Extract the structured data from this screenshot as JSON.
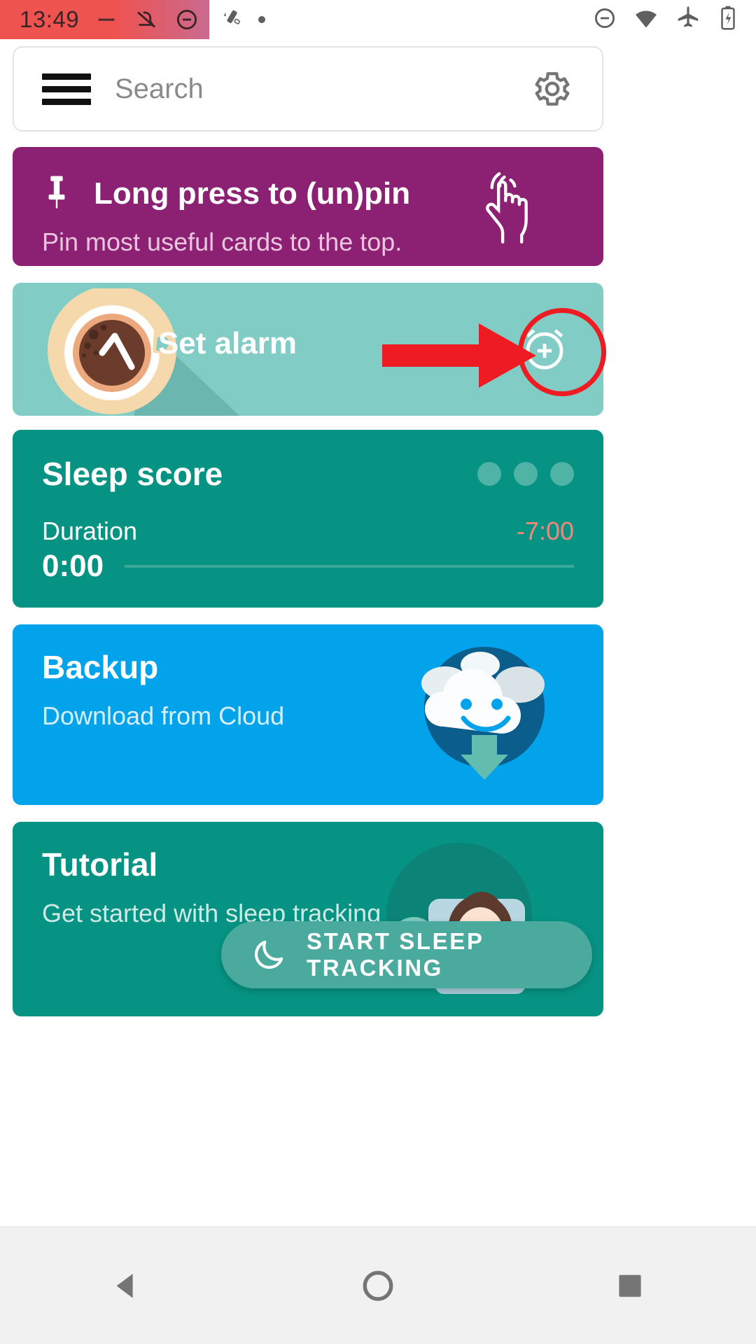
{
  "status_bar": {
    "clock": "13:49",
    "left_icons": [
      "minus-icon",
      "alarm-off-icon",
      "do-not-disturb-icon"
    ],
    "mid_icons": [
      "vibrate-off-icon",
      "dot-icon"
    ],
    "right_icons": [
      "do-not-disturb-icon",
      "wifi-icon",
      "airplane-mode-icon",
      "battery-charging-icon"
    ],
    "accent_color": "#ef5350"
  },
  "search": {
    "menu_icon": "hamburger-menu-icon",
    "placeholder": "Search",
    "value": "",
    "settings_icon": "gear-icon"
  },
  "cards": {
    "pin": {
      "icon": "pushpin-icon",
      "title": "Long press to (un)pin",
      "subtitle": "Pin most useful cards to the top.",
      "art": "tap-hand-icon",
      "color": "#8c2073"
    },
    "alarm": {
      "label": "Set alarm",
      "art": "coffee-cup-illustration",
      "action_icon": "add-alarm-icon",
      "color": "#81cdc6"
    },
    "sleep_score": {
      "title": "Sleep score",
      "dots": 3,
      "duration_label": "Duration",
      "duration_value": "0:00",
      "deficit": "-7:00",
      "deficit_color": "#f4867c",
      "progress_percent": 0,
      "color": "#069383"
    },
    "backup": {
      "title": "Backup",
      "subtitle": "Download from Cloud",
      "art": "cloud-download-illustration",
      "color": "#03a3ec"
    },
    "tutorial": {
      "title": "Tutorial",
      "subtitle": "Get started with sleep tracking",
      "art": "sleeping-person-illustration",
      "color": "#069383"
    }
  },
  "fab": {
    "icon": "moon-icon",
    "label": "START SLEEP TRACKING",
    "color": "#4aaa9e"
  },
  "annotation": {
    "arrow": "red-arrow-pointer",
    "circle": "red-highlight-circle",
    "color": "#ee1c22"
  },
  "navigation_bar": {
    "back": "back-triangle-icon",
    "home": "home-circle-icon",
    "recents": "recents-square-icon"
  }
}
